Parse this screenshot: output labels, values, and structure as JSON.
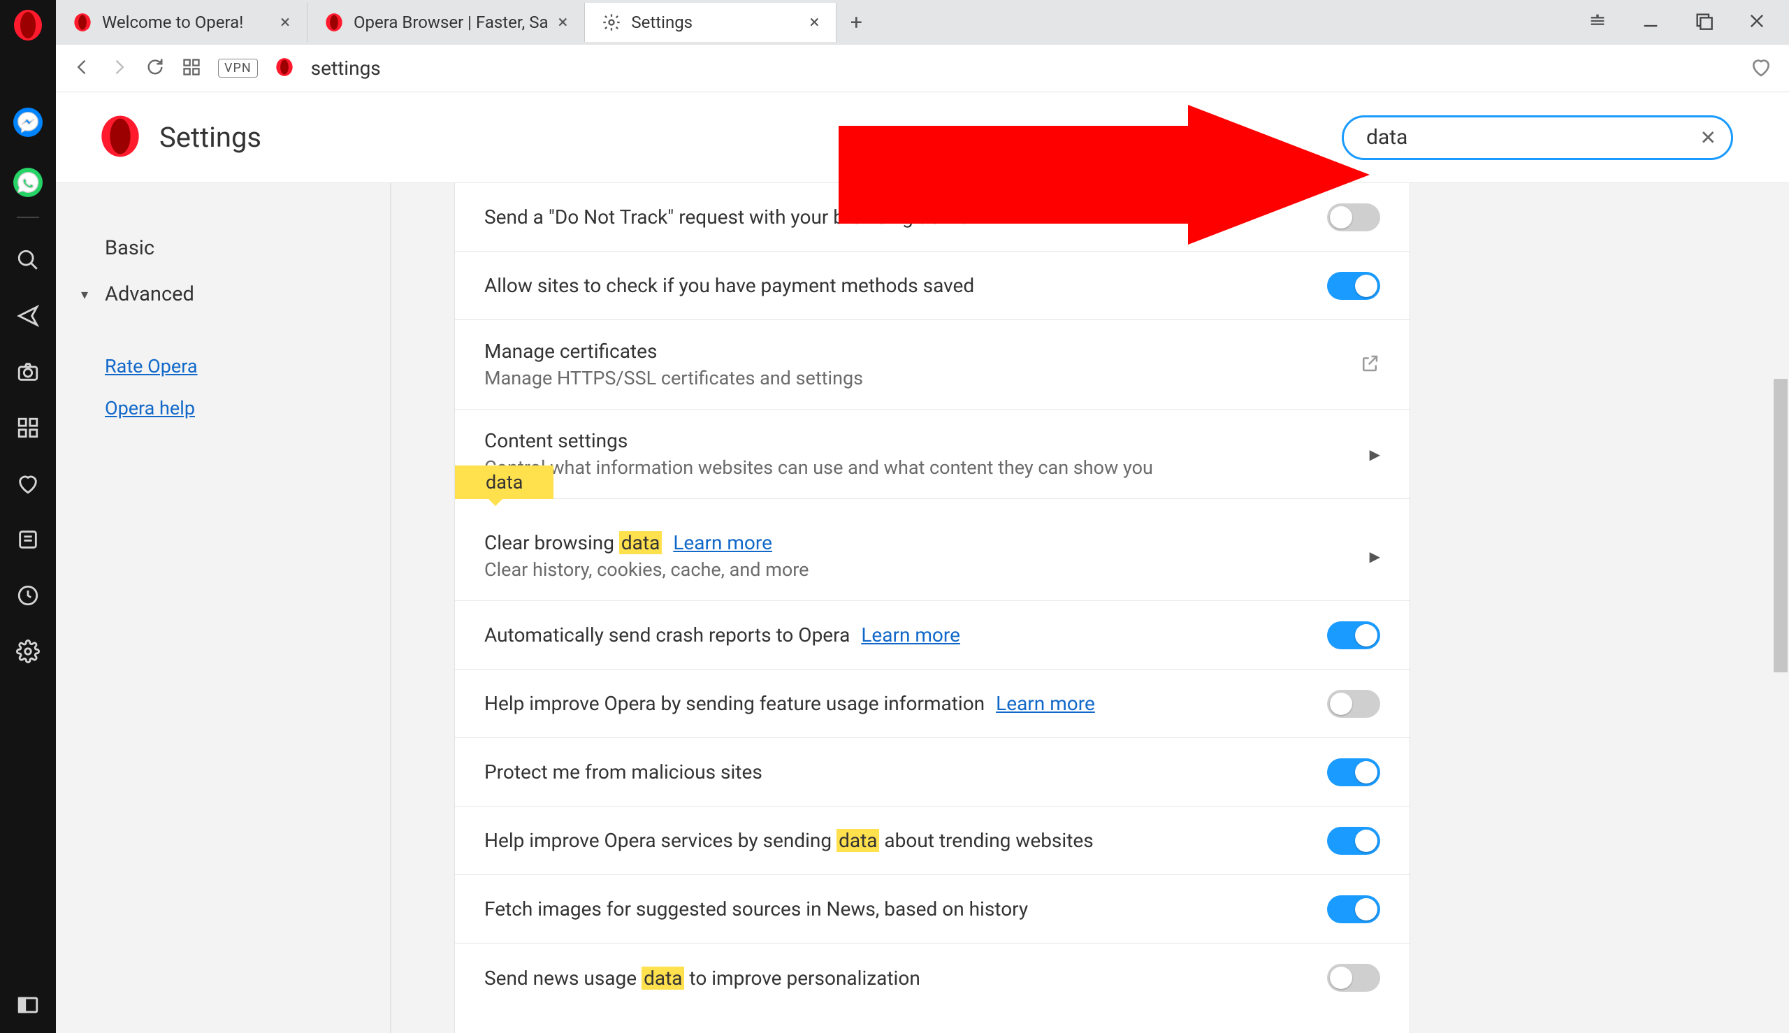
{
  "tabs": [
    {
      "title": "Welcome to Opera!",
      "favicon": "opera"
    },
    {
      "title": "Opera Browser | Faster, Sa",
      "favicon": "opera"
    },
    {
      "title": "Settings",
      "favicon": "gear",
      "active": true
    }
  ],
  "addressbar": {
    "vpn_label": "VPN",
    "url": "settings"
  },
  "settings_header": {
    "title": "Settings",
    "search_value": "data"
  },
  "sidebar_nav": {
    "basic": "Basic",
    "advanced": "Advanced",
    "rate": "Rate Opera",
    "help": "Opera help"
  },
  "tooltip_text": "data",
  "rows": {
    "dnt": {
      "title": "Send a \"Do Not Track\" request with your browsing traffic",
      "on": false
    },
    "payment": {
      "title": "Allow sites to check if you have payment methods saved",
      "on": true
    },
    "certs": {
      "title": "Manage certificates",
      "sub": "Manage HTTPS/SSL certificates and settings"
    },
    "content": {
      "title": "Content settings",
      "sub": "Control what information websites can use and what content they can show you"
    },
    "clear": {
      "title_pre": "Clear browsing ",
      "title_hl": "data",
      "learn": "Learn more",
      "sub": "Clear history, cookies, cache, and more"
    },
    "crash": {
      "title": "Automatically send crash reports to Opera",
      "learn": "Learn more",
      "on": true
    },
    "usage": {
      "title": "Help improve Opera by sending feature usage information",
      "learn": "Learn more",
      "on": false
    },
    "protect": {
      "title": "Protect me from malicious sites",
      "on": true
    },
    "trending": {
      "title_pre": "Help improve Opera services by sending ",
      "title_hl": "data",
      "title_post": " about trending websites",
      "on": true
    },
    "newsimg": {
      "title": "Fetch images for suggested sources in News, based on history",
      "on": true
    },
    "newsusage": {
      "title_pre": "Send news usage ",
      "title_hl": "data",
      "title_post": " to improve personalization",
      "on": false
    }
  }
}
